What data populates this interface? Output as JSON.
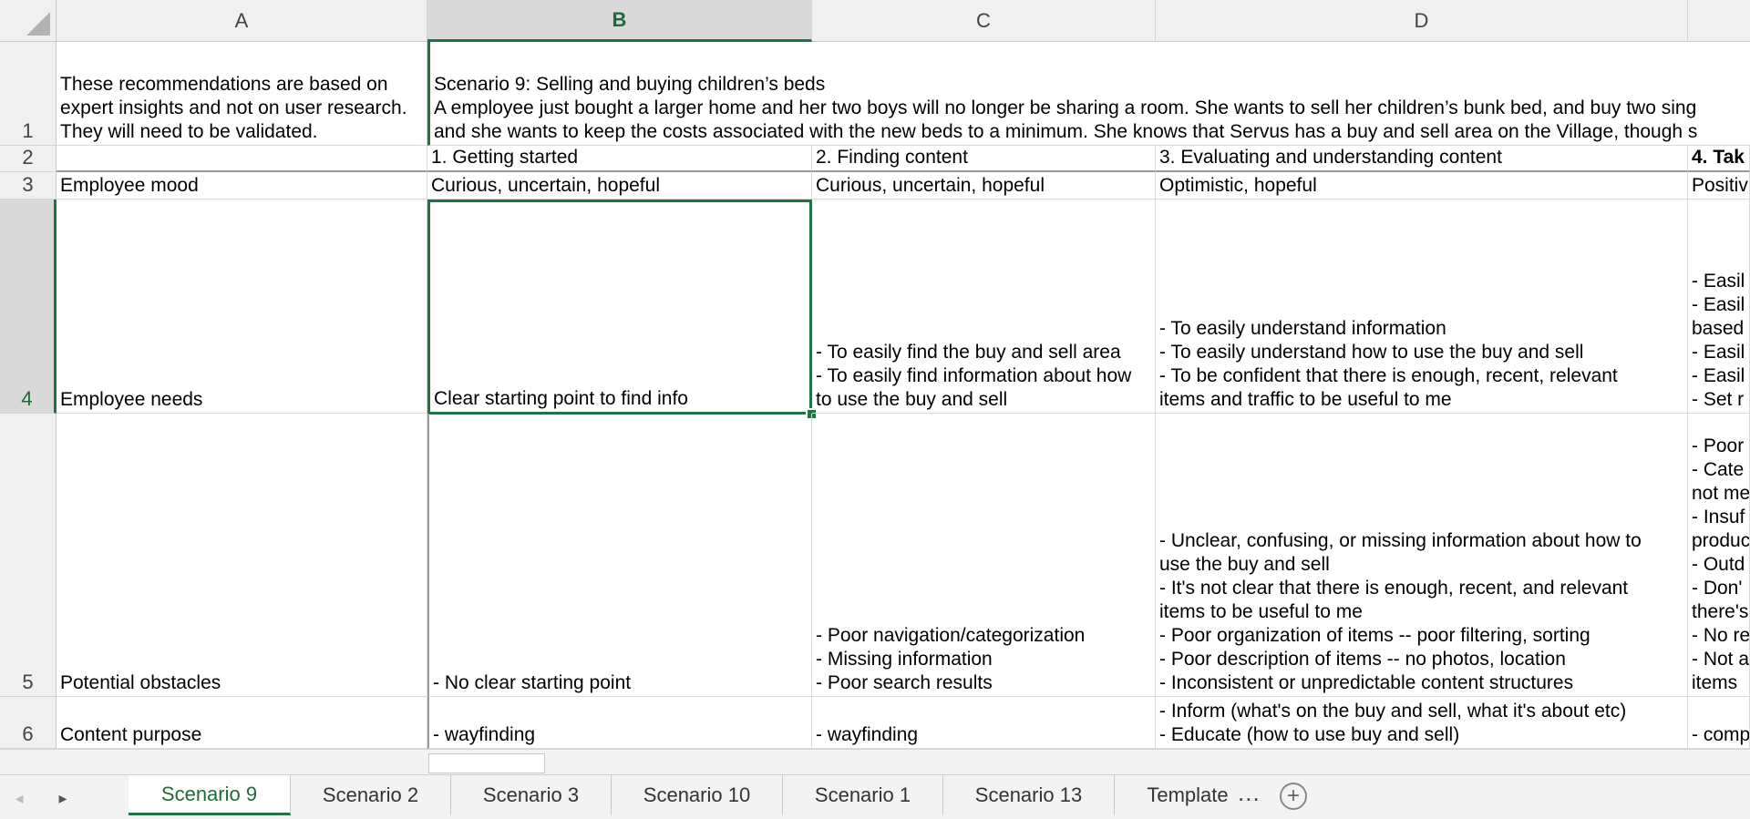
{
  "columns": [
    "A",
    "B",
    "C",
    "D"
  ],
  "rows": [
    "1",
    "2",
    "3",
    "4",
    "5",
    "6"
  ],
  "selected_cell": "B4",
  "cells": {
    "A1": [
      "These recommendations are based on",
      "expert insights and not on user research.",
      "They will need to be validated."
    ],
    "B1": [
      "Scenario 9: Selling and buying children’s beds",
      "A employee just bought a larger home and her two boys will no longer be sharing a room. She wants to sell her children’s bunk bed, and buy two sing",
      "and she wants to keep the costs associated with the new beds to a minimum. She knows that Servus has a buy and sell area on the Village, though s"
    ],
    "B2": "1. Getting started",
    "C2": "2. Finding content",
    "D2": "3. Evaluating and understanding content",
    "E2": "4. Tak",
    "A3": "Employee mood",
    "B3": "Curious, uncertain, hopeful",
    "C3": "Curious, uncertain, hopeful",
    "D3": "Optimistic, hopeful",
    "E3": "Positiv",
    "A4": "Employee needs",
    "B4": "Clear starting point to find info",
    "C4": [
      "- To easily find the buy and sell area",
      "- To easily find information about how",
      "to use the buy and sell"
    ],
    "D4": [
      "- To easily understand information",
      "- To easily understand how to use the buy and sell",
      "- To be confident that there is enough, recent, relevant",
      "items and traffic to be useful to me"
    ],
    "E4": [
      "- Easil",
      "- Easil",
      "based",
      "- Easil",
      "- Easil",
      "- Set r"
    ],
    "A5": "Potential obstacles",
    "B5": "- No clear starting point",
    "C5": [
      "- Poor navigation/categorization",
      "- Missing information",
      "- Poor search results"
    ],
    "D5": [
      "- Unclear, confusing, or missing information about how to",
      "use the buy and sell",
      "- It's not clear that there is enough, recent, and relevant",
      "items to be useful to me",
      "- Poor organization of items -- poor filtering, sorting",
      "- Poor description of items -- no photos, location",
      "- Inconsistent or unpredictable content structures"
    ],
    "E5": [
      "- Poor",
      "- Cate",
      "not me",
      "- Insuf",
      "produc",
      "- Outd",
      "- Don'",
      "there's",
      "- No re",
      "- Not a",
      "items"
    ],
    "A6": "Content purpose",
    "B6": "- wayfinding",
    "C6": "- wayfinding",
    "D6": [
      "- Inform (what's on the buy and sell, what it's about etc)",
      "- Educate (how to use buy and sell)"
    ],
    "E6": "- comp"
  },
  "sheet_tabs": [
    "Scenario 9",
    "Scenario 2",
    "Scenario 3",
    "Scenario 10",
    "Scenario 1",
    "Scenario 13",
    "Template"
  ],
  "active_tab": "Scenario 9",
  "more_tabs": "...",
  "add_sheet": "+",
  "nav": {
    "prev": "◂",
    "next": "▸"
  },
  "colors": {
    "accent": "#217346",
    "header_bg": "#f0f0f0",
    "grid": "#dadada"
  }
}
